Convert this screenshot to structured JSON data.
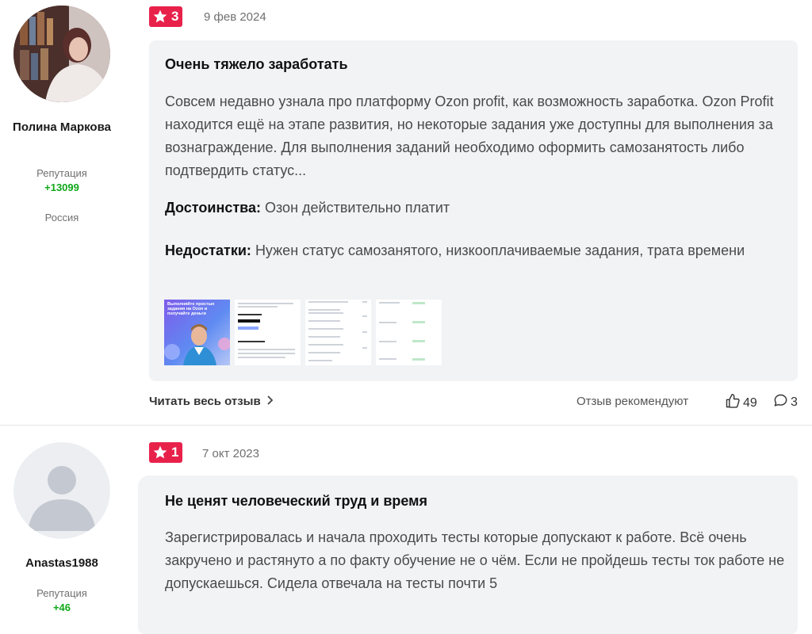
{
  "reviews": [
    {
      "author": {
        "name": "Полина Маркова",
        "reputation_label": "Репутация",
        "reputation_value": "+13099",
        "country": "Россия"
      },
      "rating": "3",
      "date": "9 фев 2024",
      "title": "Очень тяжело заработать",
      "text": "Совсем недавно узнала про платформу Ozon profit, как возможность заработка. Ozon Profit находится ещё на этапе развития, но некоторые задания уже доступны для выполнения за вознаграждение. Для выполнения заданий необходимо оформить самозанятость либо подтвердить статус...",
      "pros_label": "Достоинства:",
      "pros": "Озон действительно платит",
      "cons_label": "Недостатки:",
      "cons": "Нужен статус самозанятого, низкооплачиваемые задания, трата времени",
      "thumb_promo_text": "Выполняйте простые задания на Ozon и получайте деньги",
      "read_more": "Читать весь отзыв",
      "recommend_label": "Отзыв рекомендуют",
      "likes": "49",
      "comments": "3"
    },
    {
      "author": {
        "name": "Anastas1988",
        "reputation_label": "Репутация",
        "reputation_value": "+46"
      },
      "rating": "1",
      "date": "7 окт 2023",
      "title": "Не ценят человеческий труд и время",
      "text": "Зарегистрировалась и начала проходить тесты которые допускают к работе. Всё очень закручено и растянуто а по факту обучение не о чём. Если не пройдешь тесты ток работе не допускаешься. Сидела отвечала на тесты почти 5"
    }
  ],
  "colors": {
    "accent": "#e8214b",
    "reputation": "#10a81a",
    "bubble": "#f2f3f5"
  },
  "icons": {
    "rating": "star-icon",
    "read_more": "chevron-right-icon",
    "like": "thumbs-up-icon",
    "comment": "comment-icon"
  }
}
